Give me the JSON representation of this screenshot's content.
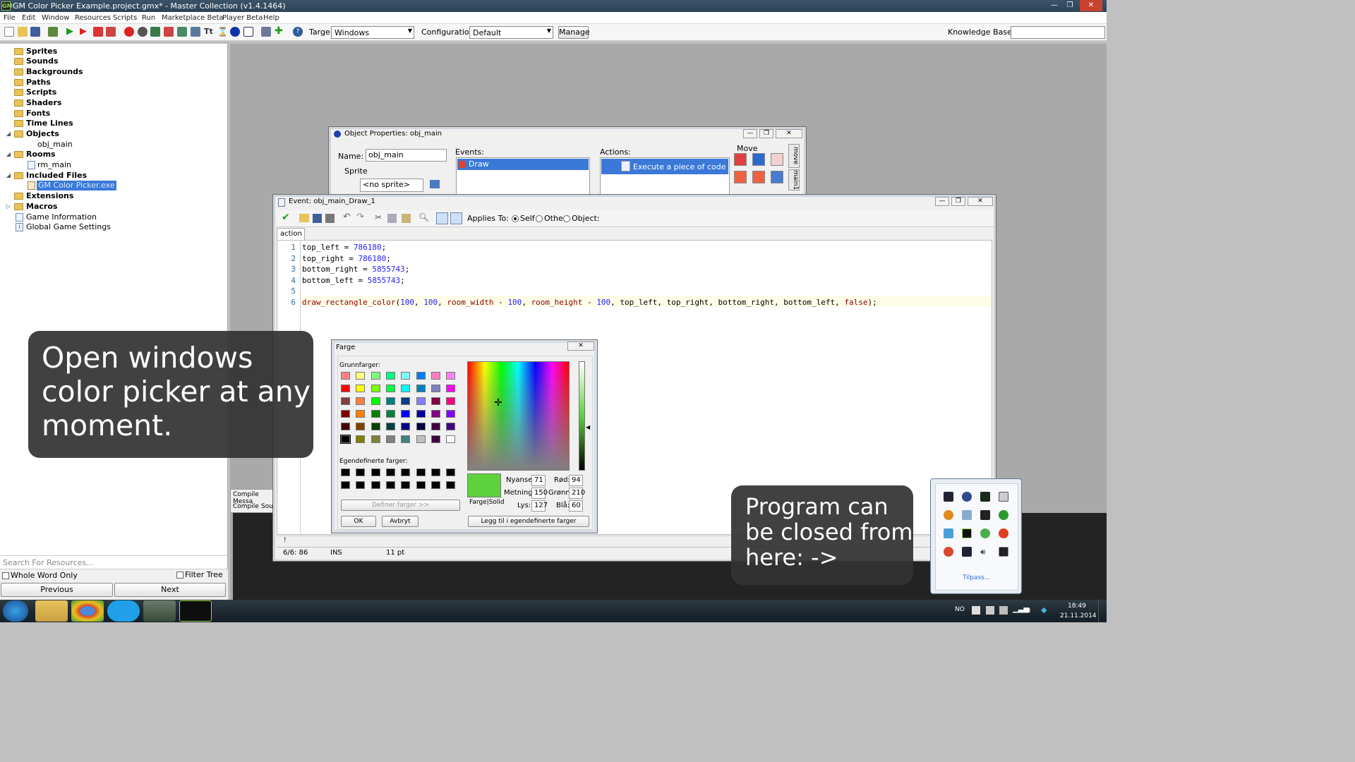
{
  "titlebar": {
    "text": "GM Color Picker Example.project.gmx* - Master Collection (v1.4.1464)",
    "minimize": "—",
    "restore": "❐",
    "close": "✕"
  },
  "menu": [
    "File",
    "Edit",
    "Window",
    "Resources",
    "Scripts",
    "Run",
    "Marketplace Beta",
    "Player Beta",
    "Help"
  ],
  "toolbar": {
    "target_label": "Targe",
    "target_value": "Windows",
    "config_label": "Configuration:",
    "config_value": "Default",
    "manage": "Manage",
    "kb_label": "Knowledge Base:"
  },
  "tree": {
    "sprites": "Sprites",
    "sounds": "Sounds",
    "backgrounds": "Backgrounds",
    "paths": "Paths",
    "scripts": "Scripts",
    "shaders": "Shaders",
    "fonts": "Fonts",
    "timelines": "Time Lines",
    "objects": "Objects",
    "obj_main": "obj_main",
    "rooms": "Rooms",
    "rm_main": "rm_main",
    "included": "Included Files",
    "gm_exe": "GM Color Picker.exe",
    "extensions": "Extensions",
    "macros": "Macros",
    "game_info": "Game Information",
    "global_settings": "Global Game Settings"
  },
  "search": {
    "placeholder": "Search For Resources...",
    "whole_word": "Whole Word Only",
    "filter_tree": "Filter Tree",
    "previous": "Previous",
    "next": "Next"
  },
  "objprops": {
    "title": "Object Properties: obj_main",
    "name_label": "Name:",
    "name_value": "obj_main",
    "sprite_label": "Sprite",
    "sprite_value": "<no sprite>",
    "events_label": "Events:",
    "event_draw": "Draw",
    "actions_label": "Actions:",
    "action_code": "Execute a piece of code",
    "move_label": "Move",
    "tab_move": "move",
    "tab_main": "main1"
  },
  "code_editor": {
    "title": "Event: obj_main_Draw_1",
    "applies_to": "Applies To:",
    "self": "Self",
    "other": "Other",
    "object": "Object:",
    "tab": "action",
    "status_pos": "6/6: 86",
    "status_mode": "INS",
    "status_size": "11 pt",
    "lines": [
      {
        "n": "1",
        "tokens": [
          {
            "t": "top_left",
            "c": "plain"
          },
          {
            "t": " = ",
            "c": "plain"
          },
          {
            "t": "786180",
            "c": "num"
          },
          {
            "t": ";",
            "c": "plain"
          }
        ]
      },
      {
        "n": "2",
        "tokens": [
          {
            "t": "top_right",
            "c": "plain"
          },
          {
            "t": " = ",
            "c": "plain"
          },
          {
            "t": "786180",
            "c": "num"
          },
          {
            "t": ";",
            "c": "plain"
          }
        ]
      },
      {
        "n": "3",
        "tokens": [
          {
            "t": "bottom_right",
            "c": "plain"
          },
          {
            "t": " = ",
            "c": "plain"
          },
          {
            "t": "5855743",
            "c": "num"
          },
          {
            "t": ";",
            "c": "plain"
          }
        ]
      },
      {
        "n": "4",
        "tokens": [
          {
            "t": "bottom_left",
            "c": "plain"
          },
          {
            "t": " = ",
            "c": "plain"
          },
          {
            "t": "5855743",
            "c": "num"
          },
          {
            "t": ";",
            "c": "plain"
          }
        ]
      },
      {
        "n": "5",
        "tokens": []
      },
      {
        "n": "6",
        "tokens": [
          {
            "t": "draw_rectangle_color",
            "c": "fn"
          },
          {
            "t": "(",
            "c": "plain"
          },
          {
            "t": "100",
            "c": "num"
          },
          {
            "t": ", ",
            "c": "plain"
          },
          {
            "t": "100",
            "c": "num"
          },
          {
            "t": ", ",
            "c": "plain"
          },
          {
            "t": "room_width",
            "c": "id"
          },
          {
            "t": " - ",
            "c": "plain"
          },
          {
            "t": "100",
            "c": "num"
          },
          {
            "t": ", ",
            "c": "plain"
          },
          {
            "t": "room_height",
            "c": "id"
          },
          {
            "t": " - ",
            "c": "plain"
          },
          {
            "t": "100",
            "c": "num"
          },
          {
            "t": ", ",
            "c": "plain"
          },
          {
            "t": "top_left",
            "c": "plain"
          },
          {
            "t": ", ",
            "c": "plain"
          },
          {
            "t": "top_right",
            "c": "plain"
          },
          {
            "t": ", ",
            "c": "plain"
          },
          {
            "t": "bottom_right",
            "c": "plain"
          },
          {
            "t": ", ",
            "c": "plain"
          },
          {
            "t": "bottom_left",
            "c": "plain"
          },
          {
            "t": ", ",
            "c": "plain"
          },
          {
            "t": "false",
            "c": "kw"
          },
          {
            "t": ");",
            "c": "plain"
          }
        ]
      }
    ]
  },
  "compile": {
    "title": "Compile Messa",
    "tab_compile": "Compile",
    "tab_source": "Sou"
  },
  "color_dialog": {
    "title": "Farge",
    "basic": "Grunnfarger:",
    "custom": "Egendefinerte farger:",
    "define": "Definer farger >>",
    "ok": "OK",
    "cancel": "Avbryt",
    "add_custom": "Legg til i egendefinerte farger",
    "solid": "Farge|Solid",
    "hue_label": "Nyanse:",
    "hue": "71",
    "sat_label": "Metning:",
    "sat": "150",
    "lum_label": "Lys:",
    "lum": "127",
    "red_label": "Rød:",
    "red": "94",
    "green_label": "Grønn:",
    "green": "210",
    "blue_label": "Blå:",
    "blue": "60",
    "selected_color": "#5ed23c",
    "basic_colors": [
      "#ff8080",
      "#ffff80",
      "#80ff80",
      "#00ff80",
      "#80ffff",
      "#0080ff",
      "#ff80c0",
      "#ff80ff",
      "#ff0000",
      "#ffff00",
      "#80ff00",
      "#00ff40",
      "#00ffff",
      "#0080c0",
      "#8080c0",
      "#ff00ff",
      "#804040",
      "#ff8040",
      "#00ff00",
      "#008080",
      "#004080",
      "#8080ff",
      "#800040",
      "#ff0080",
      "#800000",
      "#ff8000",
      "#008000",
      "#008040",
      "#0000ff",
      "#0000a0",
      "#800080",
      "#8000ff",
      "#400000",
      "#804000",
      "#004000",
      "#004040",
      "#000080",
      "#000040",
      "#400040",
      "#400080",
      "#000000",
      "#808000",
      "#808040",
      "#808080",
      "#408080",
      "#c0c0c0",
      "#400040",
      "#ffffff"
    ]
  },
  "overlay_left": "Open windows color picker at any moment.",
  "overlay_right": "Program can be closed from here: ->",
  "tray": {
    "customize": "Tilpass..."
  },
  "taskbar": {
    "lang": "NO",
    "time": "18:49",
    "date": "21.11.2014"
  }
}
